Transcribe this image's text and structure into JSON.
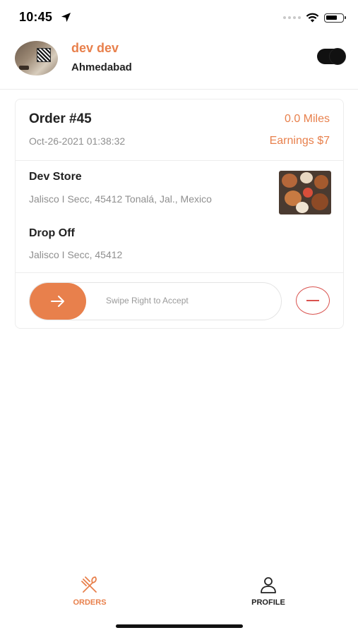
{
  "status_bar": {
    "time": "10:45",
    "icons": [
      "location-arrow-icon",
      "cellular-signal-icon",
      "wifi-icon",
      "battery-icon"
    ]
  },
  "header": {
    "user_name": "dev dev",
    "city": "Ahmedabad",
    "availability_toggle": "on"
  },
  "order": {
    "title": "Order #45",
    "date": "Oct-26-2021 01:38:32",
    "distance": "0.0 Miles",
    "earnings": "Earnings $7",
    "store": {
      "name": "Dev Store",
      "address": "Jalisco I Secc, 45412 Tonalá, Jal., Mexico"
    },
    "dropoff": {
      "label": "Drop Off",
      "address": "Jalisco I Secc, 45412"
    },
    "swipe_text": "Swipe Right to Accept"
  },
  "tabs": [
    {
      "label": "ORDERS",
      "icon": "fork-knife-icon",
      "active": true
    },
    {
      "label": "PROFILE",
      "icon": "person-icon",
      "active": false
    }
  ],
  "colors": {
    "accent": "#e8804c",
    "reject": "#d9534f",
    "muted_text": "#8f8f8f"
  }
}
